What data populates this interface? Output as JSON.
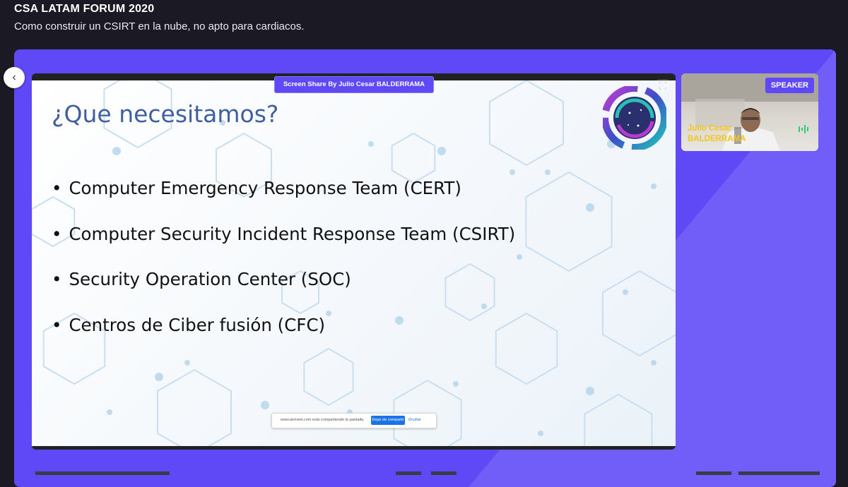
{
  "header": {
    "event_title": "CSA LATAM FORUM 2020",
    "session_subtitle": "Como construir un CSIRT en la nube, no apto para cardiacos."
  },
  "screen_share": {
    "badge": "Screen Share By Julio Cesar BALDERRAMA",
    "slide": {
      "title": "¿Que necesitamos?",
      "bullets": [
        "Computer Emergency Response Team (CERT)",
        "Computer Security Incident Response Team (CSIRT)",
        "Security Operation Center (SOC)",
        "Centros de Ciber fusión (CFC)"
      ]
    },
    "share_bar": {
      "message": "www.airmeet.com está compartiendo tu pantalla.",
      "stop_label": "Dejar de compartir",
      "hide_label": "Ocultar"
    }
  },
  "speaker": {
    "badge": "SPEAKER",
    "name_line1": "Julio Cesar",
    "name_line2": "BALDERRAMA"
  },
  "icons": {
    "collapse": "chevron-left-icon",
    "fullscreen": "fullscreen-icon",
    "audio": "audio-level-icon"
  },
  "colors": {
    "accent": "#5f48f6",
    "slide_title": "#3f5f9e",
    "speaker_name": "#f5c518"
  }
}
